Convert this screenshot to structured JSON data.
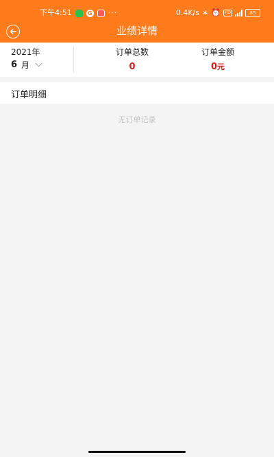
{
  "status_bar": {
    "time": "下午4:51",
    "dots": "···",
    "speed": "0.4K/s",
    "battery": "85"
  },
  "header": {
    "title": "业绩详情"
  },
  "summary": {
    "year": "2021年",
    "month": "6",
    "month_unit": "月",
    "total_orders_label": "订单总数",
    "total_orders_value": "0",
    "total_amount_label": "订单金额",
    "total_amount_value": "0",
    "total_amount_unit": "元"
  },
  "orders": {
    "section_title": "订单明细",
    "empty_text": "无订单记录"
  },
  "colors": {
    "header_bg": "#ff7b1c",
    "value_red": "#c8241b"
  }
}
